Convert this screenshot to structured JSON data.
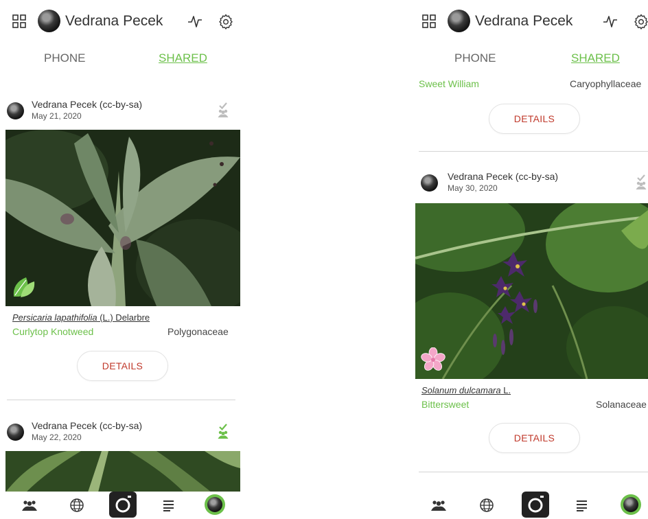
{
  "app": {
    "user_name": "Vedrana Pecek",
    "accent_color": "#6cc04a",
    "details_color": "#c0392b"
  },
  "tabs": {
    "phone": "PHONE",
    "shared": "SHARED"
  },
  "left_screen": {
    "posts": [
      {
        "author": "Vedrana Pecek (cc-by-sa)",
        "date": "May 21, 2020",
        "status": "shared-pending",
        "scientific_name": "Persicaria lapathifolia",
        "authority": " (L.) Delarbre",
        "common_name": "Curlytop Knotweed",
        "family": "Polygonaceae",
        "badge": "leaf-icon",
        "details_label": "DETAILS"
      },
      {
        "author": "Vedrana Pecek (cc-by-sa)",
        "date": "May 22, 2020",
        "status": "shared-confirmed"
      }
    ]
  },
  "right_screen": {
    "top_partial": {
      "common_name": "Sweet William",
      "family": "Caryophyllaceae",
      "details_label": "DETAILS"
    },
    "posts": [
      {
        "author": "Vedrana Pecek (cc-by-sa)",
        "date": "May 30, 2020",
        "status": "shared-pending",
        "scientific_name": "Solanum dulcamara",
        "authority": " L.",
        "common_name": "Bittersweet",
        "family": "Solanaceae",
        "badge": "flower-icon",
        "details_label": "DETAILS"
      }
    ]
  },
  "bottom_nav": {
    "items": [
      "community-icon",
      "globe-icon",
      "camera-icon",
      "list-icon",
      "profile-avatar"
    ]
  }
}
